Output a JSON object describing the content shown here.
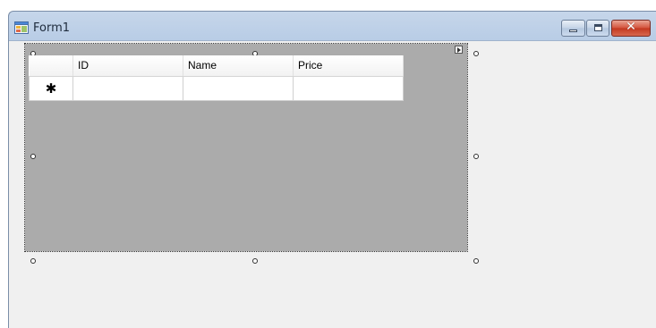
{
  "window": {
    "title": "Form1",
    "icon": "winforms-form-icon",
    "controls": {
      "minimize": "minimize-icon",
      "maximize": "maximize-icon",
      "close_glyph": "✕"
    }
  },
  "grid": {
    "columns": [
      "ID",
      "Name",
      "Price"
    ],
    "new_row_marker": "✱",
    "rows": [
      {
        "cells": [
          "",
          "",
          ""
        ]
      }
    ],
    "background_color": "#ababab"
  },
  "designer": {
    "selected_control": "dataGridView",
    "smart_tag_icon": "smart-tag-arrow-icon"
  }
}
